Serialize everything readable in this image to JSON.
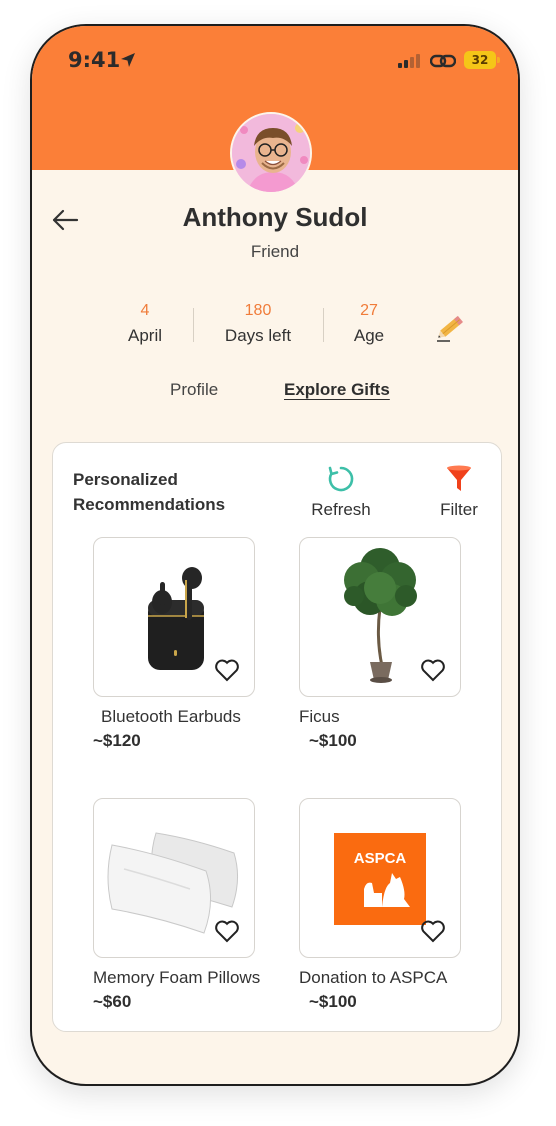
{
  "status": {
    "time": "9:41",
    "battery": "32"
  },
  "profile": {
    "name": "Anthony Sudol",
    "relation": "Friend"
  },
  "stats": [
    {
      "value": "4",
      "label": "April"
    },
    {
      "value": "180",
      "label": "Days left"
    },
    {
      "value": "27",
      "label": "Age"
    }
  ],
  "tabs": {
    "profile": "Profile",
    "explore": "Explore Gifts",
    "active": "explore"
  },
  "recommendations": {
    "title_line1": "Personalized",
    "title_line2": "Recommendations",
    "refresh_label": "Refresh",
    "filter_label": "Filter",
    "items": [
      {
        "name": "Bluetooth Earbuds",
        "price": "~$120",
        "icon": "earbuds"
      },
      {
        "name": "Ficus",
        "price": "~$100",
        "icon": "ficus-plant"
      },
      {
        "name": "Memory Foam Pillows",
        "price": "~$60",
        "icon": "pillows"
      },
      {
        "name": "Donation to ASPCA",
        "price": "~$100",
        "icon": "aspca-logo",
        "logo_text": "ASPCA"
      }
    ]
  },
  "colors": {
    "accent": "#fb7f38",
    "background": "#fdf5ea",
    "refresh": "#3dbfa8",
    "filter": "#f0411b"
  }
}
